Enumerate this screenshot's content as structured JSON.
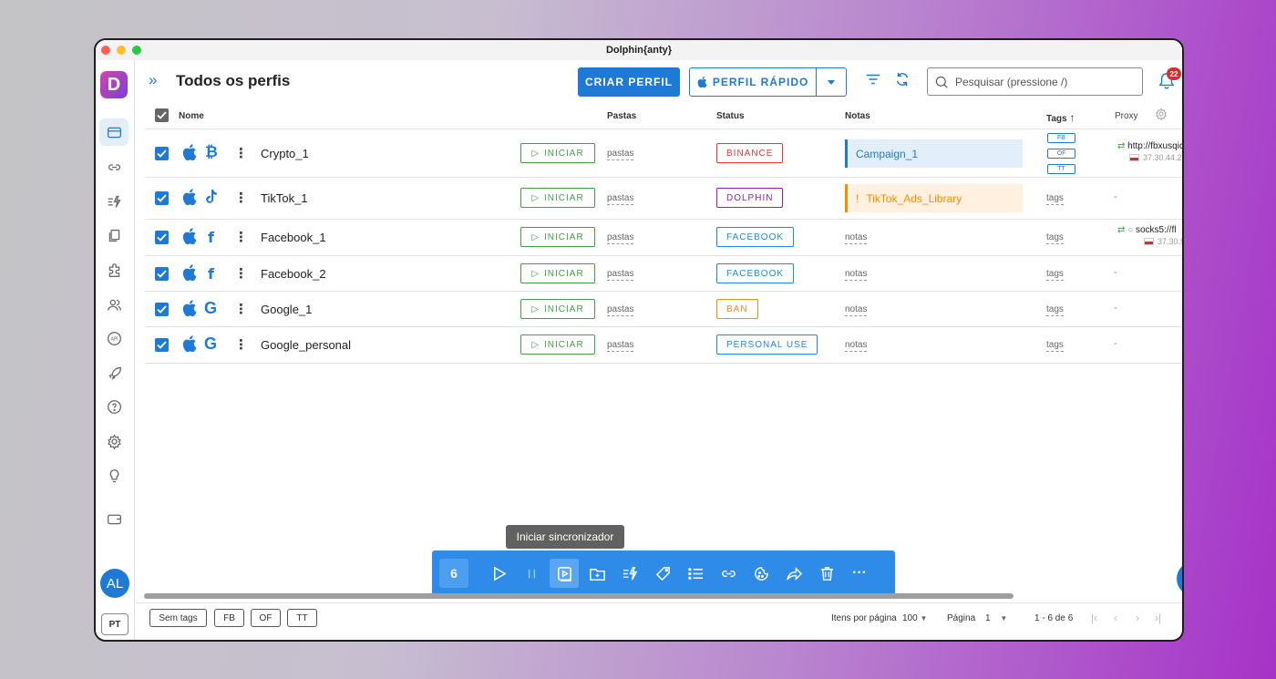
{
  "window": {
    "title": "Dolphin{anty}"
  },
  "sidebar": {
    "logo": "D",
    "user_initials": "AL",
    "language": "PT",
    "items": [
      {
        "icon": "browser-profiles-icon",
        "active": true
      },
      {
        "icon": "link-icon",
        "active": false
      },
      {
        "icon": "automation-icon",
        "active": false
      },
      {
        "icon": "copy-icon",
        "active": false
      },
      {
        "icon": "puzzle-extensions-icon",
        "active": false
      },
      {
        "icon": "users-icon",
        "active": false
      },
      {
        "icon": "api-icon",
        "active": false
      },
      {
        "icon": "rocket-icon",
        "active": false
      },
      {
        "icon": "help-icon",
        "active": false
      },
      {
        "icon": "settings-icon",
        "active": false
      },
      {
        "icon": "lightbulb-icon",
        "active": false
      },
      {
        "icon": "wallet-icon",
        "active": false
      }
    ]
  },
  "header": {
    "title": "Todos os perfis",
    "create_label": "CRIAR PERFIL",
    "quick_label": "PERFIL RÁPIDO",
    "search_placeholder": "Pesquisar (pressione /)",
    "notifications": "22"
  },
  "table": {
    "columns": {
      "name": "Nome",
      "folders": "Pastas",
      "status": "Status",
      "notes": "Notas",
      "tags": "Tags",
      "proxy": "Proxy"
    },
    "start_label": "INICIAR",
    "rows": [
      {
        "name": "Crypto_1",
        "icon": "bitcoin-icon",
        "folders": "pastas",
        "status": "BINANCE",
        "status_color": "#e53935",
        "note": "Campaign_1",
        "tags": [
          "FB",
          "OF",
          "TT"
        ],
        "proxy": "http://fbxusqic",
        "proxy_ip": "37.30.44.2"
      },
      {
        "name": "TikTok_1",
        "icon": "tiktok-icon",
        "folders": "pastas",
        "status": "DOLPHIN",
        "status_color": "#8e24aa",
        "note": "TikTok_Ads_Library",
        "note_alert": "!",
        "tags_text": "tags",
        "proxy_dash": "-"
      },
      {
        "name": "Facebook_1",
        "icon": "facebook-icon",
        "folders": "pastas",
        "status": "FACEBOOK",
        "status_color": "#1e88e5",
        "notes_text": "notas",
        "tags_text": "tags",
        "proxy": "socks5://fl",
        "proxy_ip": "37.30.5"
      },
      {
        "name": "Facebook_2",
        "icon": "facebook-icon",
        "folders": "pastas",
        "status": "FACEBOOK",
        "status_color": "#1e88e5",
        "notes_text": "notas",
        "tags_text": "tags",
        "proxy_dash": "-"
      },
      {
        "name": "Google_1",
        "icon": "google-icon",
        "folders": "pastas",
        "status": "BAN",
        "status_color": "#fb8c00",
        "notes_text": "notas",
        "tags_text": "tags",
        "proxy_dash": "-"
      },
      {
        "name": "Google_personal",
        "icon": "google-icon",
        "folders": "pastas",
        "status": "PERSONAL USE",
        "status_color": "#1e88e5",
        "notes_text": "notas",
        "tags_text": "tags",
        "proxy_dash": "-"
      }
    ]
  },
  "toolbar": {
    "selected_count": "6",
    "tooltip": "Iniciar sincronizador"
  },
  "footer": {
    "tag_filters": [
      "Sem tags",
      "FB",
      "OF",
      "TT"
    ],
    "per_page_label": "Itens por página",
    "per_page_value": "100",
    "page_label": "Página",
    "page_value": "1",
    "range": "1 - 6 de 6"
  },
  "colors": {
    "accent": "#1f7ad6",
    "start_green": "#43a047",
    "note_blue_bg": "#e3eefb",
    "note_orange_bg": "#fff0e0",
    "note_orange_text": "#fb8c00"
  }
}
